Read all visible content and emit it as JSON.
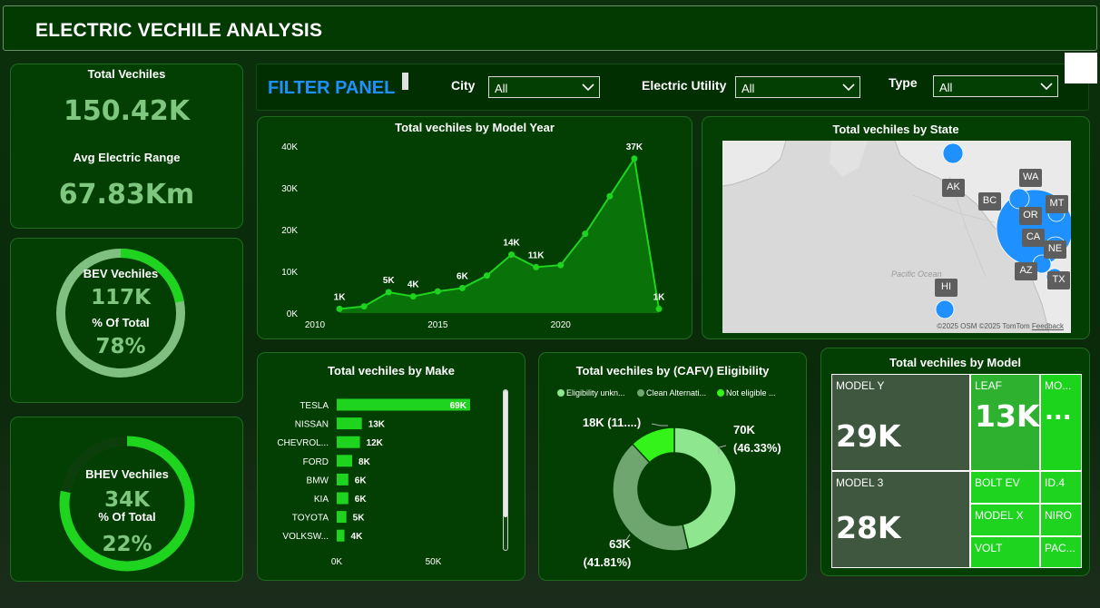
{
  "header": {
    "title": "ELECTRIC VECHILE ANALYSIS"
  },
  "kpi": {
    "total_label": "Total Vechiles",
    "total_value": "150.42K",
    "range_label": "Avg Electric Range",
    "range_value": "67.83Km"
  },
  "bev": {
    "label": "BEV Vechiles",
    "value": "117K",
    "pct_label": "% Of Total",
    "pct_value": "78%",
    "fraction": 0.78
  },
  "bhev": {
    "label": "BHEV Vechiles",
    "value": "34K",
    "pct_label": "% Of Total",
    "pct_value": "22%",
    "fraction": 0.22
  },
  "filter": {
    "title": "FILTER PANEL",
    "city_label": "City",
    "city_value": "All",
    "utility_label": "Electric Utility",
    "utility_value": "All",
    "type_label": "Type",
    "type_value": "All"
  },
  "line_chart": {
    "title": "Total vechiles by Model Year",
    "y_ticks": [
      "0K",
      "10K",
      "20K",
      "30K",
      "40K"
    ],
    "x_ticks": [
      "2010",
      "2015",
      "2020"
    ]
  },
  "map": {
    "title": "Total vechiles by State",
    "ocean_label": "Pacific Ocean",
    "states": [
      "AK",
      "BC",
      "WA",
      "MT",
      "OR",
      "CA",
      "NE",
      "AZ",
      "TX",
      "HI"
    ],
    "copyright_osm": "©2025 OSM",
    "copyright_tomtom": "©2025 TomTom",
    "feedback": "Feedback"
  },
  "make_chart": {
    "title": "Total vechiles by Make",
    "x_ticks": [
      "0K",
      "50K"
    ]
  },
  "cafv_chart": {
    "title": "Total vechiles by (CAFV) Eligibility",
    "legend": [
      "Eligibility unkn...",
      "Clean Alternati...",
      "Not eligible ..."
    ],
    "labels": [
      {
        "line1": "70K",
        "line2": "(46.33%)"
      },
      {
        "line1": "63K",
        "line2": "(41.81%)"
      },
      {
        "line1": "18K (11....)",
        "line2": ""
      }
    ]
  },
  "treemap": {
    "title": "Total vechiles by Model",
    "cells": [
      {
        "label": "MODEL Y",
        "value": "29K"
      },
      {
        "label": "MODEL 3",
        "value": "28K"
      },
      {
        "label": "LEAF",
        "value": "13K"
      },
      {
        "label": "MO...",
        "value": "..."
      },
      {
        "label": "BOLT EV",
        "value": ""
      },
      {
        "label": "ID.4",
        "value": ""
      },
      {
        "label": "MODEL X",
        "value": ""
      },
      {
        "label": "NIRO",
        "value": ""
      },
      {
        "label": "VOLT",
        "value": ""
      },
      {
        "label": "PAC...",
        "value": ""
      }
    ]
  },
  "colors": {
    "accent_green": "#1ed41e",
    "bright_green": "#33f31a",
    "muted_green": "#6fa56f",
    "light_green": "#8ee68e",
    "kpi_text": "#7fc77f",
    "filter_title": "#1e90ff",
    "map_bubble": "#1e90ff"
  },
  "chart_data": [
    {
      "type": "area",
      "title": "Total vechiles by Model Year",
      "x": [
        2011,
        2012,
        2013,
        2014,
        2015,
        2016,
        2017,
        2018,
        2019,
        2020,
        2021,
        2022,
        2023,
        2024
      ],
      "values": [
        1000,
        1600,
        5000,
        4000,
        5200,
        6000,
        9000,
        14000,
        11000,
        11500,
        19000,
        28000,
        37000,
        1000
      ],
      "data_labels": [
        "1K",
        "",
        "5K",
        "4K",
        "",
        "6K",
        "",
        "14K",
        "11K",
        "",
        "",
        "",
        "37K",
        "1K"
      ],
      "xlim": [
        2010,
        2024
      ],
      "ylim": [
        0,
        40000
      ],
      "grid": false
    },
    {
      "type": "bar",
      "title": "Total vechiles by Make",
      "categories": [
        "TESLA",
        "NISSAN",
        "CHEVROL...",
        "FORD",
        "BMW",
        "KIA",
        "TOYOTA",
        "VOLKSW..."
      ],
      "values": [
        69000,
        13000,
        12000,
        8000,
        6000,
        6000,
        5000,
        4000
      ],
      "data_labels": [
        "69K",
        "13K",
        "12K",
        "8K",
        "6K",
        "6K",
        "5K",
        "4K"
      ],
      "xlim": [
        0,
        100000
      ],
      "orientation": "horizontal"
    },
    {
      "type": "pie",
      "title": "Total vechiles by (CAFV) Eligibility",
      "categories": [
        "Eligibility unkn...",
        "Clean Alternati...",
        "Not eligible ..."
      ],
      "values": [
        70000,
        63000,
        18000
      ],
      "donut": true,
      "legend": "top"
    }
  ]
}
